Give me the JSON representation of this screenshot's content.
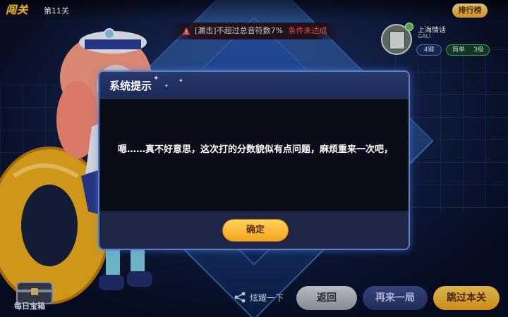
{
  "header": {
    "mode_title": "闯关",
    "level_label": "第11关",
    "rank_button": "排行榜"
  },
  "condition": {
    "text": "[漏击]不超过总音符数7%",
    "status": "条件未达成"
  },
  "song": {
    "title": "上海情话",
    "artist": "GALI",
    "keys": "4键",
    "difficulty": "简单",
    "level": "3级"
  },
  "dialog": {
    "title": "系统提示",
    "message": "嗯……真不好意思，这次打的分数貌似有点问题，麻烦重来一次吧，",
    "confirm_label": "确定"
  },
  "bottom": {
    "treasure_label": "每日宝箱",
    "share_label": "炫耀一下",
    "back_label": "返回",
    "retry_label": "再来一局",
    "skip_label": "跳过本关"
  },
  "colors": {
    "accent_gold": "#f2a51c",
    "fail_red": "#ff5a4a",
    "dialog_border": "#5b7fc4"
  }
}
